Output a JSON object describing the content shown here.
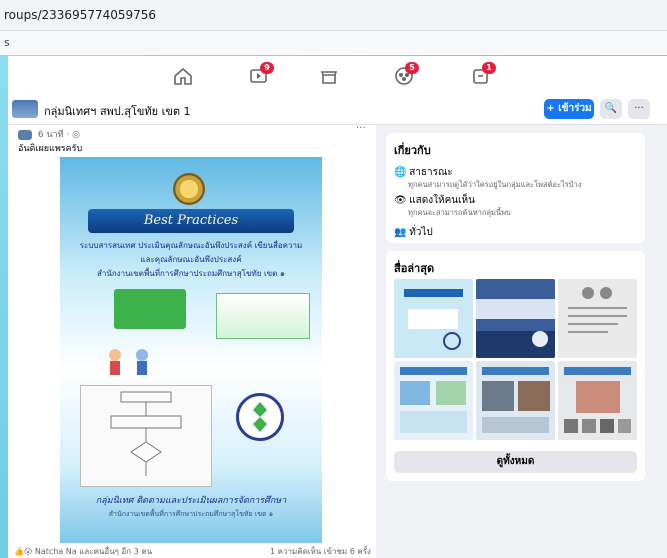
{
  "browser": {
    "url": "roups/233695774059756",
    "bookmarks_text": "s"
  },
  "nav": {
    "items": [
      {
        "icon": "home-icon",
        "badge": ""
      },
      {
        "icon": "watch-icon",
        "badge": "9"
      },
      {
        "icon": "marketplace-icon",
        "badge": ""
      },
      {
        "icon": "groups-icon",
        "badge": "5"
      },
      {
        "icon": "gaming-icon",
        "badge": "1"
      }
    ]
  },
  "group": {
    "name": "กลุ่มนิเทศฯ สพป.สุโขทัย เขต 1",
    "join_label": "+ เข้าร่วม",
    "search_label": "🔍",
    "more_label": "···"
  },
  "post": {
    "time": "6 นาที · ◎",
    "text": "อันดิเผยแพรครับ",
    "more": "···",
    "poster": {
      "title": "Best Practices",
      "line1": "ระบบสารสนเทศ ประเมินคุณลักษณะอันพึงประสงค์ เขียนสื่อความ",
      "line2": "และคุณลักษณะอันพึงประสงค์",
      "line3": "สำนักงานเขตพื้นที่การศึกษาประถมศึกษาสุโขทัย เขต ๑",
      "bottom1": "กลุ่มนิเทศ ติดตามและประเมินผลการจัดการศึกษา",
      "bottom2": "สำนักงานเขตพื้นที่การศึกษาประถมศึกษาสุโขทัย เขต ๑"
    },
    "reactions": "Natcha Na และคนอื่นๆ อีก 3 คน",
    "stats": "1 ความคิดเห็น เข้าชม 6 ครั้ง"
  },
  "about": {
    "title": "เกี่ยวกับ",
    "public_label": "สาธารณะ",
    "public_desc": "ทุกคนสามารถดูได้ว่าใครอยู่ในกลุ่มและโพสต์อะไรบ้าง",
    "visible_label": "แสดงให้คนเห็น",
    "visible_desc": "ทุกคนจะสามารถค้นหากลุ่มนี้พบ",
    "general_label": "ทั่วไป"
  },
  "media": {
    "title": "สื่อล่าสุด",
    "see_all": "ดูทั้งหมด",
    "thumbs": [
      {
        "bg": "#cbe9f5"
      },
      {
        "bg": "#3b5e98"
      },
      {
        "bg": "#e9e9e9"
      },
      {
        "bg": "#e5f0f8"
      },
      {
        "bg": "#dfe8f0"
      },
      {
        "bg": "#e6e8ea"
      }
    ]
  },
  "colors": {
    "accent": "#1877f2",
    "badge": "#e41e3f",
    "feed_bg": "#f0f2f5"
  }
}
